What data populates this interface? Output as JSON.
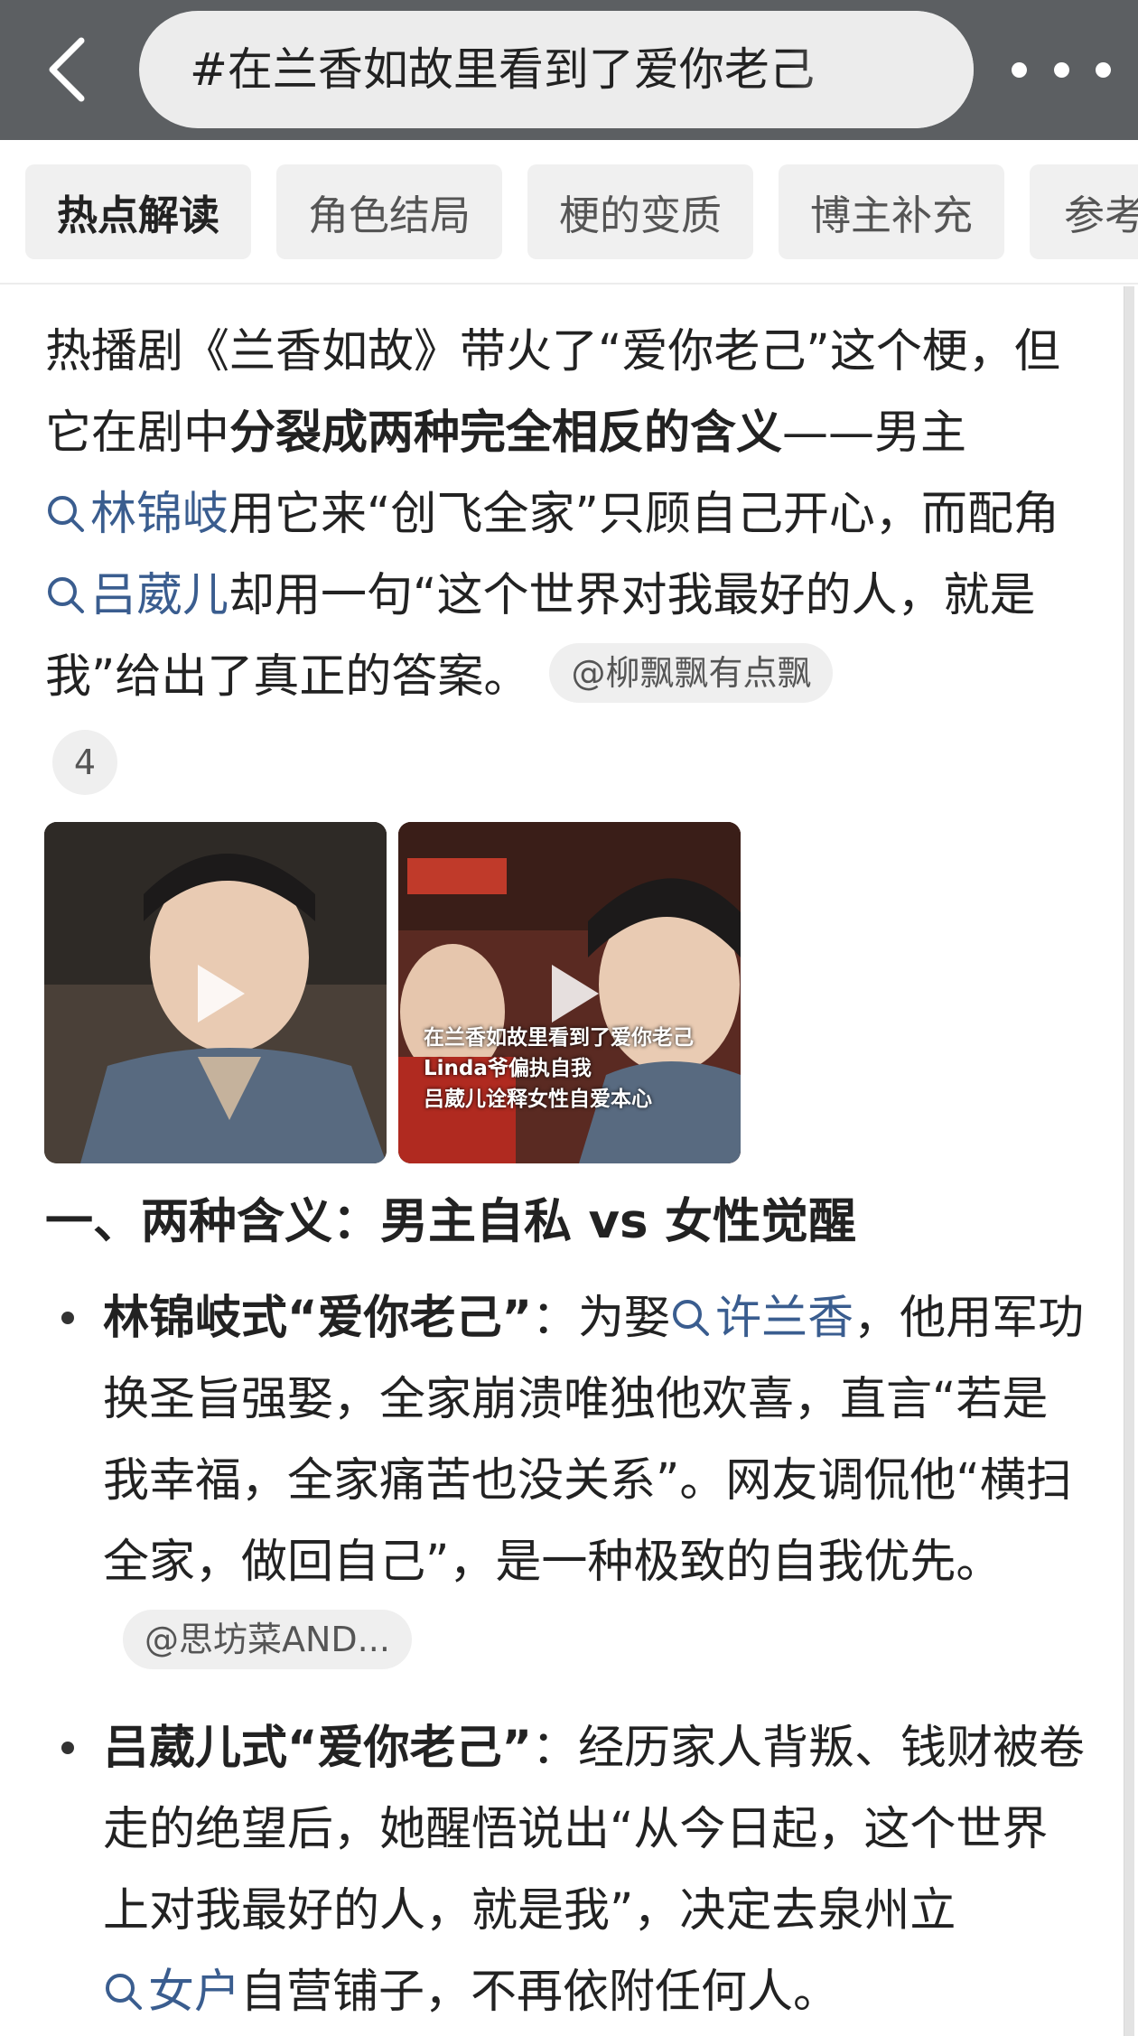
{
  "header": {
    "search_query": "#在兰香如故里看到了爱你老己"
  },
  "tabs": [
    {
      "label": "热点解读",
      "active": true
    },
    {
      "label": "角色结局",
      "active": false
    },
    {
      "label": "梗的变质",
      "active": false
    },
    {
      "label": "博主补充",
      "active": false
    },
    {
      "label": "参考",
      "active": false
    }
  ],
  "intro": {
    "t1": "热播剧《兰香如故》带火了“爱你老己”这个梗，但它在剧中",
    "bold": "分裂成两种完全相反的含义",
    "t2": "——男主",
    "link1": "林锦岐",
    "t3": "用它来“创飞全家”只顾自己开心，而配角",
    "link2": "吕葳儿",
    "t4": "却用一句“这个世界对我最好的人，就是我”给出了真正的答案。",
    "source": "@柳飘飘有点飘",
    "source_count": "4"
  },
  "videos": [
    {
      "caption": ""
    },
    {
      "caption_lines": [
        "在兰香如故里看到了爱你老己",
        "Linda爷偏执自我",
        "吕葳儿诠释女性自爱本心"
      ]
    }
  ],
  "section1": {
    "heading": "一、两种含义：男主自私 vs 女性觉醒",
    "bullets": [
      {
        "title": "林锦岐式“爱你老己”",
        "t1": "：为娶",
        "link": "许兰香",
        "t2": "，他用军功换圣旨强娶，全家崩溃唯独他欢喜，直言“若是我幸福，全家痛苦也没关系”。网友调侃他“横扫全家，做回自己”，是一种极致的自我优先。",
        "source": "@思坊菜AND..."
      },
      {
        "title": "吕葳儿式“爱你老己”",
        "t1": "：经历家人背叛、钱财被卷走的绝望后，她醒悟说出“从今日起，这个世界上对我最好的人，就是我”，决定去泉州立",
        "link": "女户",
        "t2": "自营铺子，不再依附任何人。"
      }
    ]
  },
  "colors": {
    "topbar": "#5c5f62",
    "link": "#3a5d8f",
    "chip_bg": "#efefef"
  }
}
